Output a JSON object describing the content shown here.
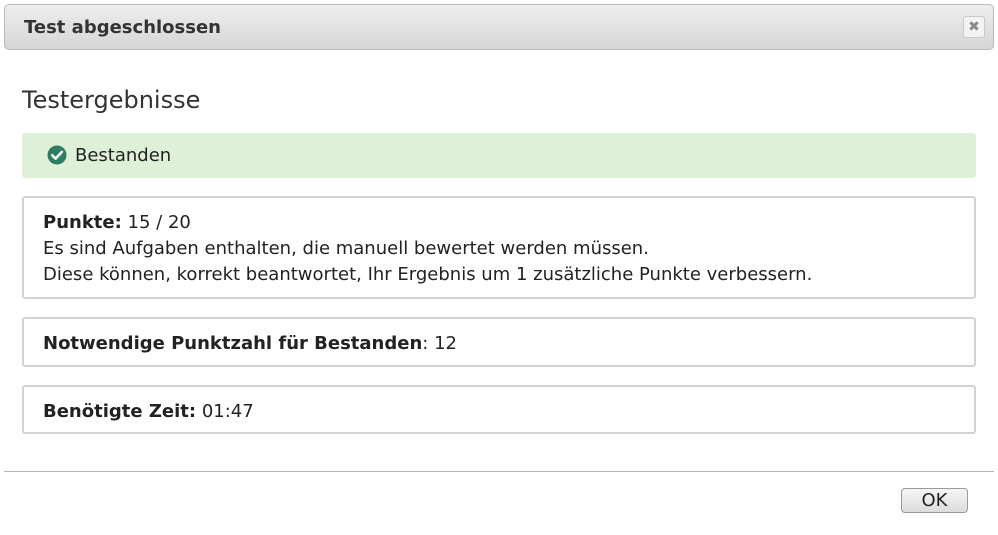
{
  "dialog": {
    "title": "Test abgeschlossen",
    "close_icon": "close-icon",
    "close_glyph": "✖"
  },
  "results": {
    "heading": "Testergebnisse",
    "status": {
      "text": "Bestanden",
      "icon": "check-circle-icon",
      "color": "#2e7d63",
      "background": "#dff0d8"
    },
    "score": {
      "label": "Punkte:",
      "value": "15 / 20",
      "note_line1": "Es sind Aufgaben enthalten, die manuell bewertet werden müssen.",
      "note_line2": "Diese können, korrekt beantwortet, Ihr Ergebnis um 1 zusätzliche Punkte verbessern."
    },
    "required": {
      "label": "Notwendige Punktzahl für Bestanden",
      "value": ": 12"
    },
    "time": {
      "label": "Benötigte Zeit:",
      "value": "01:47"
    }
  },
  "footer": {
    "ok_label": "OK"
  }
}
